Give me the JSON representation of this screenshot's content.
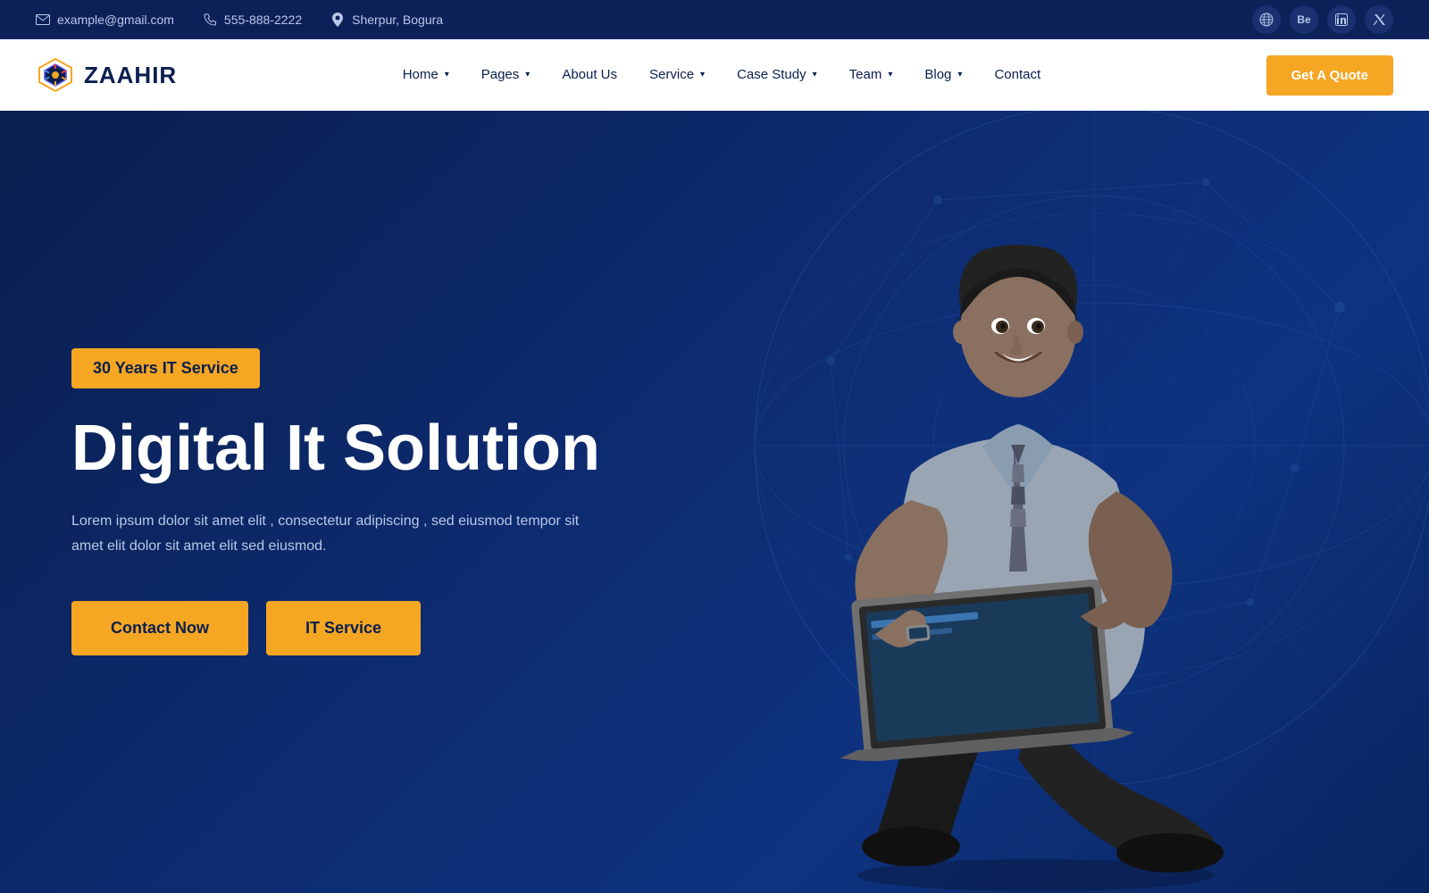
{
  "topbar": {
    "email": "example@gmail.com",
    "phone": "555-888-2222",
    "location": "Sherpur, Bogura"
  },
  "social": {
    "globe_label": "🌐",
    "behance_label": "Be",
    "linkedin_label": "in",
    "twitter_label": "𝕏"
  },
  "navbar": {
    "logo_text": "ZAAHIR",
    "nav_items": [
      {
        "label": "Home",
        "has_dropdown": true
      },
      {
        "label": "Pages",
        "has_dropdown": true
      },
      {
        "label": "About Us",
        "has_dropdown": false
      },
      {
        "label": "Service",
        "has_dropdown": true
      },
      {
        "label": "Case Study",
        "has_dropdown": true
      },
      {
        "label": "Team",
        "has_dropdown": true
      },
      {
        "label": "Blog",
        "has_dropdown": true
      },
      {
        "label": "Contact",
        "has_dropdown": false
      }
    ],
    "cta_label": "Get A Quote"
  },
  "hero": {
    "badge": "30 Years IT Service",
    "title": "Digital It Solution",
    "description": "Lorem ipsum dolor sit amet elit , consectetur adipiscing , sed eiusmod tempor sit amet elit dolor sit amet elit sed eiusmod.",
    "btn_contact": "Contact Now",
    "btn_service": "IT Service"
  }
}
